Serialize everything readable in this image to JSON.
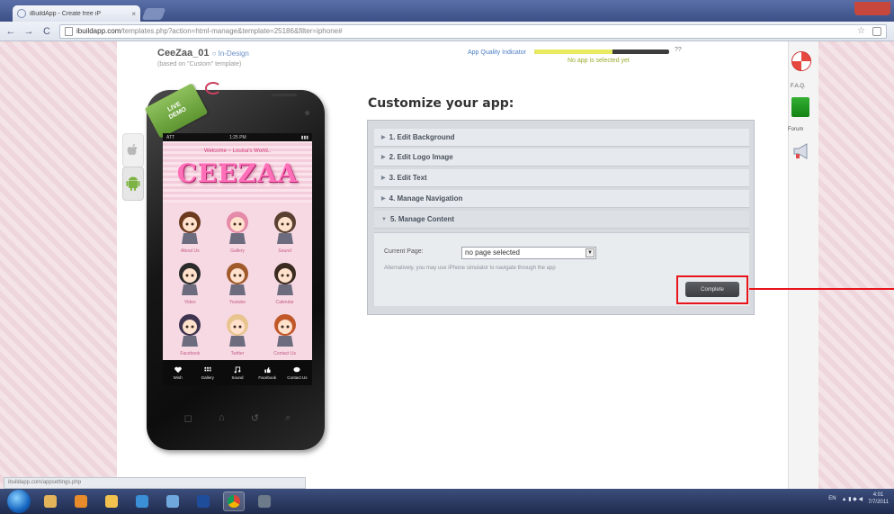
{
  "browser": {
    "tab_title": "iBuildApp - Create free iP",
    "tab_close": "×",
    "url_domain": "ibuildapp.com",
    "url_path": "/templates.php?action=html-manage&template=25186&filter=iphone#",
    "nav": {
      "back": "←",
      "forward": "→",
      "reload": "C"
    },
    "star": "☆"
  },
  "app": {
    "name": "CeeZaa_01",
    "mode": "In-Design",
    "subtitle": "(based on \"Custom\" template)",
    "quality_label": "App Quality Indicator",
    "quality_tip": "No app is selected yet",
    "quality_score": "??",
    "quality_fill_percent": 58
  },
  "phone": {
    "badge_line1": "LIVE",
    "badge_line2": "DEMO",
    "status_left": "ATT",
    "status_center": "1:25 PM",
    "status_right": "▮▮▮",
    "welcome": "Welcome ~ Louisa's World..",
    "brand": "CEEZAA",
    "grid": [
      {
        "label": "About Us",
        "hair": "#6b3a1f"
      },
      {
        "label": "Gallery",
        "hair": "#e58aa8"
      },
      {
        "label": "Sound",
        "hair": "#5a4030"
      },
      {
        "label": "Video",
        "hair": "#2b2b2b"
      },
      {
        "label": "Youtube",
        "hair": "#a05a2c"
      },
      {
        "label": "Calendar",
        "hair": "#3a2a20"
      },
      {
        "label": "Facebook",
        "hair": "#3f3550"
      },
      {
        "label": "Twitter",
        "hair": "#e8c48e"
      },
      {
        "label": "Contact Us",
        "hair": "#c0582a"
      }
    ],
    "tabs": [
      "Wish",
      "Gallery",
      "Sound",
      "Facebook",
      "Contact Us"
    ],
    "keys": [
      "◻",
      "⌂",
      "↺",
      "⌕"
    ]
  },
  "customize": {
    "title": "Customize your app:",
    "sections": [
      "1. Edit Background",
      "2. Edit Logo Image",
      "3. Edit Text",
      "4. Manage Navigation",
      "5. Manage Content"
    ],
    "current_page_label": "Current Page:",
    "current_page_value": "no page selected",
    "note": "Alternatively, you may use iPhone simulator to navigate through the app",
    "complete_label": "Complete"
  },
  "sidebar": {
    "faq_label": "F.A.Q.",
    "forum_label": "Forum"
  },
  "status_link": "ibuildapp.com/appsettings.php",
  "tray": {
    "lang": "EN",
    "time": "4:01",
    "date": "7/7/2011"
  }
}
